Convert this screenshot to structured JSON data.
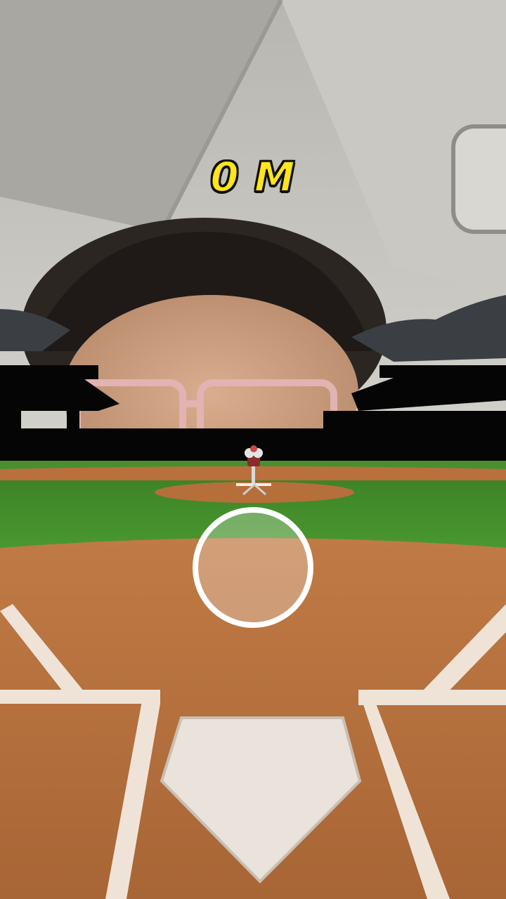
{
  "hud": {
    "distance_value": "0",
    "distance_unit": "M",
    "distance_text": "0 M"
  },
  "aim_target": {
    "label": "aim-target"
  },
  "colors": {
    "distance_text": "#FFE51A",
    "outfield_grass": "#3f8a2a",
    "infield_dirt": "#b9703d",
    "chalk_lines": "#f1e6dc",
    "stadium_silhouette": "#050505"
  }
}
